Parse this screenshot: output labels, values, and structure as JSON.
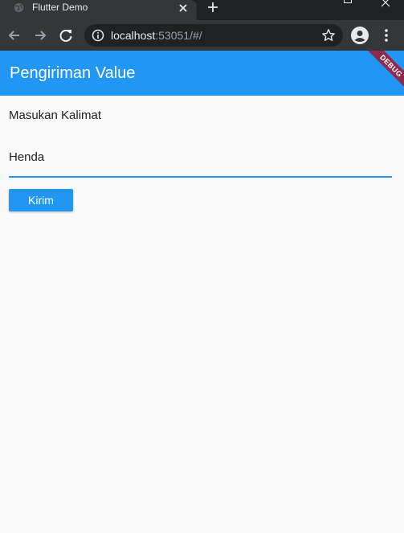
{
  "browser": {
    "tab_title": "Flutter Demo",
    "url_host": "localhost",
    "url_rest": ":53051/#/",
    "icons": {
      "favicon": "globe-icon",
      "tab_close": "close-icon",
      "new_tab": "plus-icon",
      "back": "arrow-left-icon",
      "forward": "arrow-right-icon",
      "reload": "reload-icon",
      "site_info": "info-icon",
      "bookmark": "star-icon",
      "profile": "account-icon",
      "menu": "more-vert-icon"
    }
  },
  "app": {
    "title": "Pengiriman Value",
    "debug_banner": "DEBUG",
    "label": "Masukan Kalimat",
    "input_value": "Henda",
    "submit_label": "Kirim",
    "colors": {
      "primary": "#2196f3",
      "debug_banner": "#8e2b4b",
      "background": "#fafafa"
    }
  }
}
